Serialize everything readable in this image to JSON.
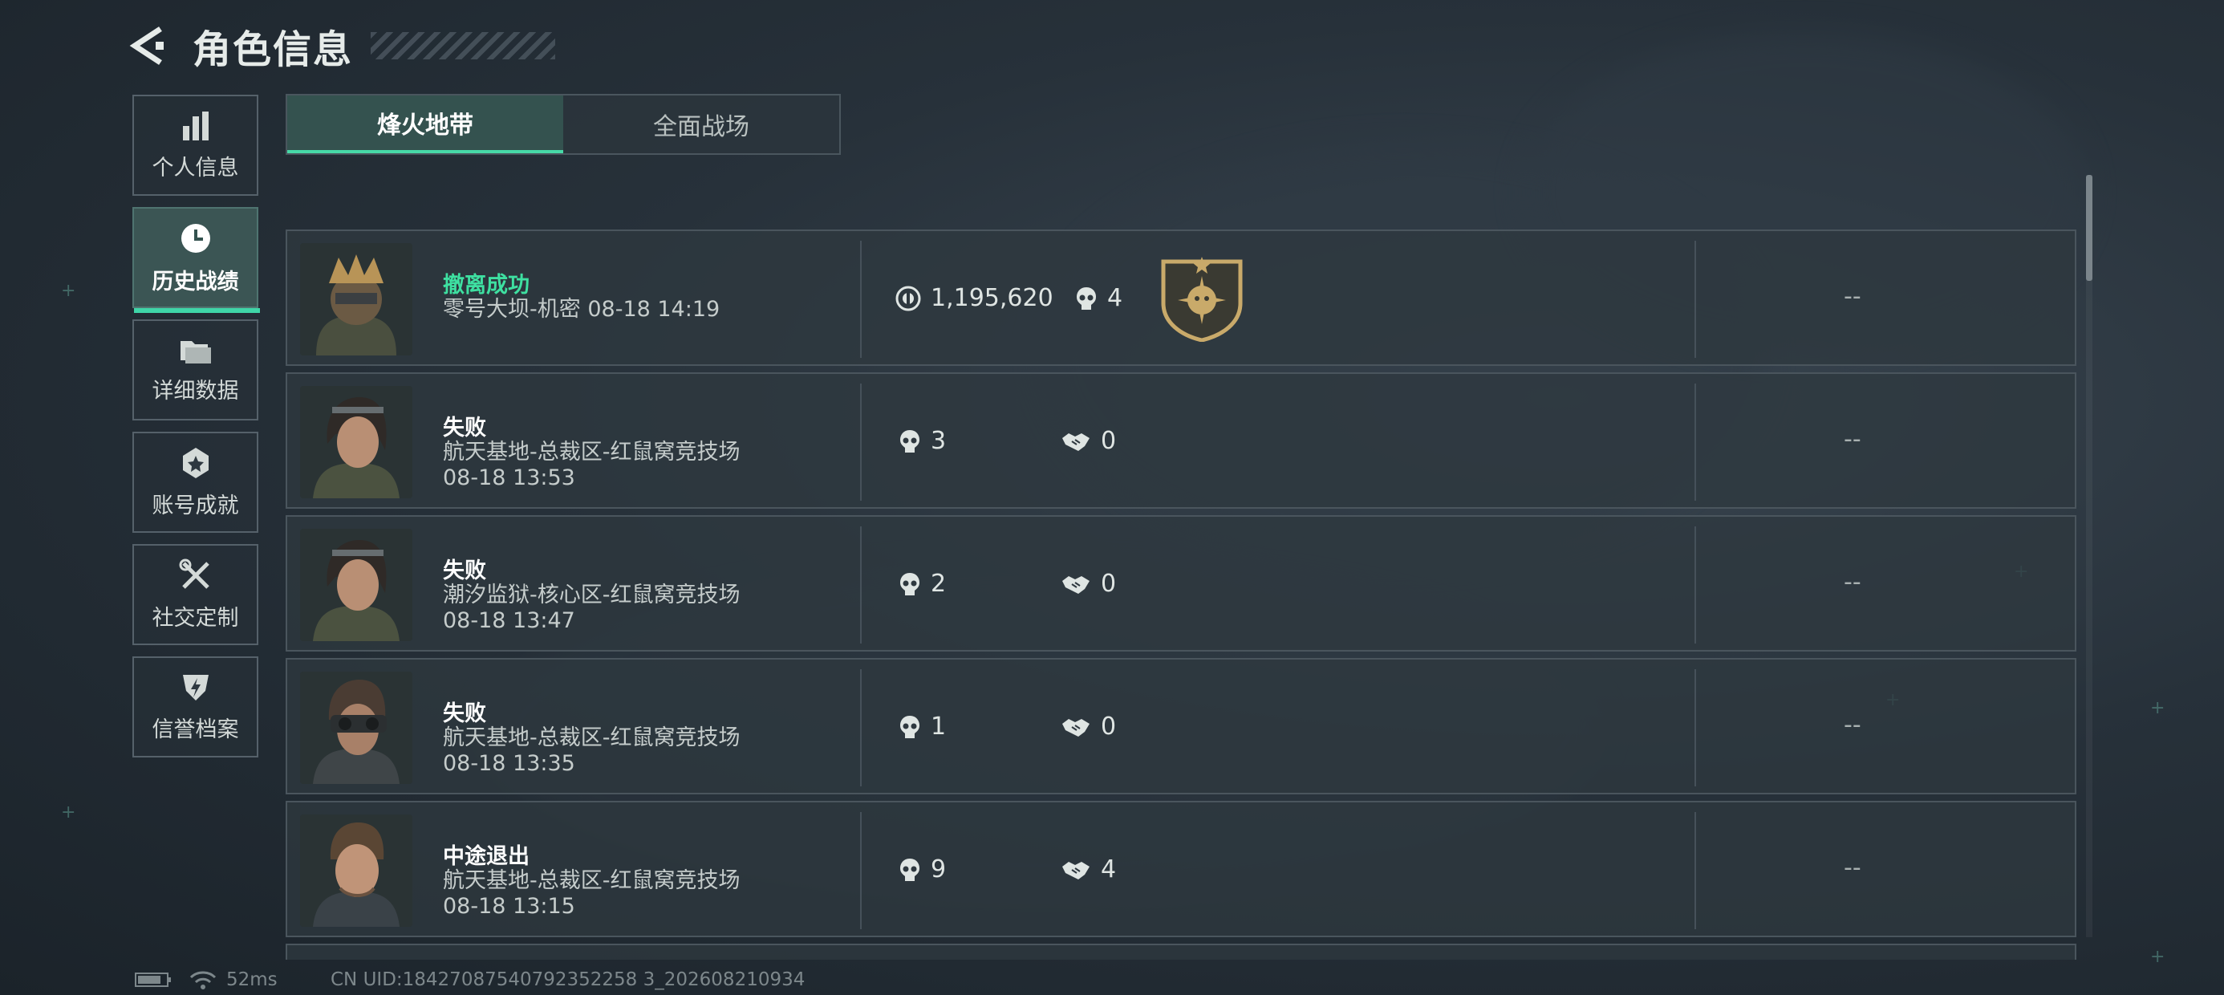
{
  "header": {
    "title": "角色信息"
  },
  "nav": {
    "items": [
      {
        "label": "个人信息",
        "icon": "bar-chart-icon"
      },
      {
        "label": "历史战绩",
        "icon": "clock-icon",
        "active": true
      },
      {
        "label": "详细数据",
        "icon": "folder-icon"
      },
      {
        "label": "账号成就",
        "icon": "badge-icon"
      },
      {
        "label": "社交定制",
        "icon": "tools-icon"
      },
      {
        "label": "信誉档案",
        "icon": "shield-icon"
      }
    ]
  },
  "tabs": [
    {
      "label": "烽火地带",
      "active": true
    },
    {
      "label": "全面战场",
      "active": false
    }
  ],
  "matches": [
    {
      "status": "撤离成功",
      "map": "零号大坝-机密",
      "time": "08-18 14:19",
      "value": "1,195,620",
      "kills": "4",
      "rescues": "",
      "rating": "--"
    },
    {
      "status": "失败",
      "map": "航天基地-总裁区-红鼠窝竞技场",
      "time": "08-18 13:53",
      "value": "",
      "kills": "3",
      "rescues": "0",
      "rating": "--"
    },
    {
      "status": "失败",
      "map": "潮汐监狱-核心区-红鼠窝竞技场",
      "time": "08-18 13:47",
      "value": "",
      "kills": "2",
      "rescues": "0",
      "rating": "--"
    },
    {
      "status": "失败",
      "map": "航天基地-总裁区-红鼠窝竞技场",
      "time": "08-18 13:35",
      "value": "",
      "kills": "1",
      "rescues": "0",
      "rating": "--"
    },
    {
      "status": "中途退出",
      "map": "航天基地-总裁区-红鼠窝竞技场",
      "time": "08-18 13:15",
      "value": "",
      "kills": "9",
      "rescues": "4",
      "rating": "--"
    }
  ],
  "footer": {
    "ping": "52ms",
    "uid": "CN UID:18427087540792352258 3_202608210934"
  },
  "colors": {
    "accent": "#3fd6a8",
    "success": "#3ee0a1"
  }
}
